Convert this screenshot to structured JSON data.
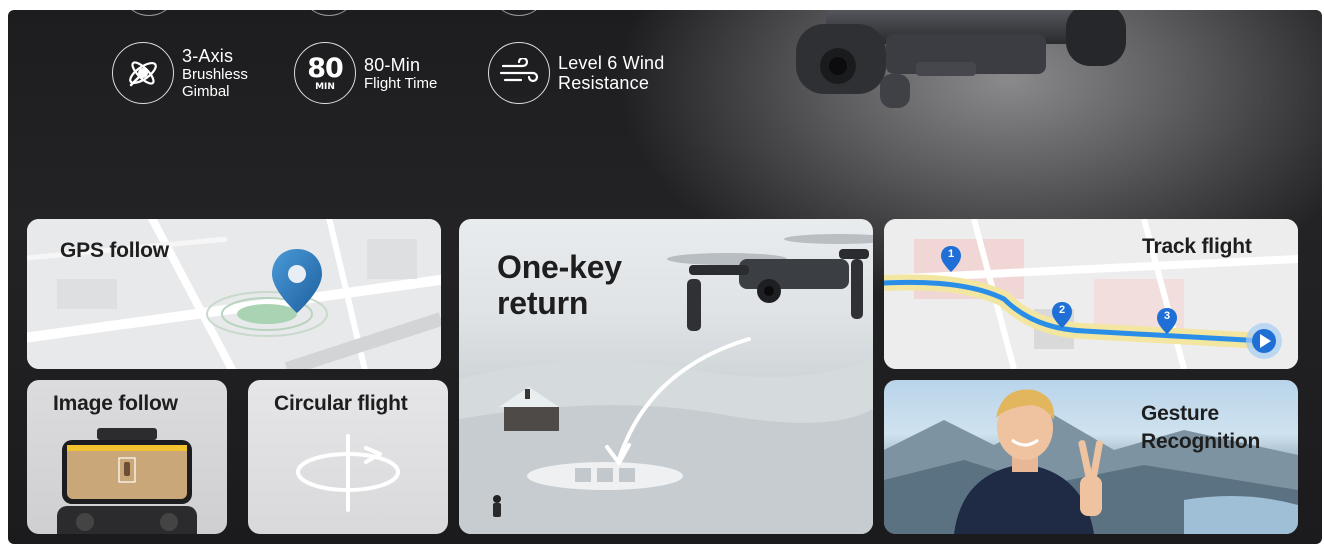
{
  "features": [
    {
      "title": "3-Axis",
      "sub1": "Brushless",
      "sub2": "Gimbal",
      "icon": "gimbal-icon"
    },
    {
      "number": "80",
      "number_unit": "MIN",
      "title": "80-Min",
      "sub1": "Flight Time",
      "icon": "flight-time-badge-icon"
    },
    {
      "title": "Level 6 Wind",
      "title2": "Resistance",
      "icon": "wind-icon"
    }
  ],
  "cards": {
    "gps_follow": {
      "title": "GPS follow"
    },
    "image_follow": {
      "title": "Image follow"
    },
    "circular_flight": {
      "title": "Circular flight"
    },
    "one_key_return": {
      "title_line1": "One-key",
      "title_line2": "return"
    },
    "track_flight": {
      "title": "Track flight",
      "waypoints": [
        "1",
        "2",
        "3"
      ]
    },
    "gesture_recognition": {
      "title_line1": "Gesture",
      "title_line2": "Recognition"
    }
  },
  "colors": {
    "background_dark": "#1d1d1f",
    "accent_blue": "#1f6fd6",
    "pin_blue": "#2d7fc4",
    "route_blue": "#2a8ee8"
  }
}
